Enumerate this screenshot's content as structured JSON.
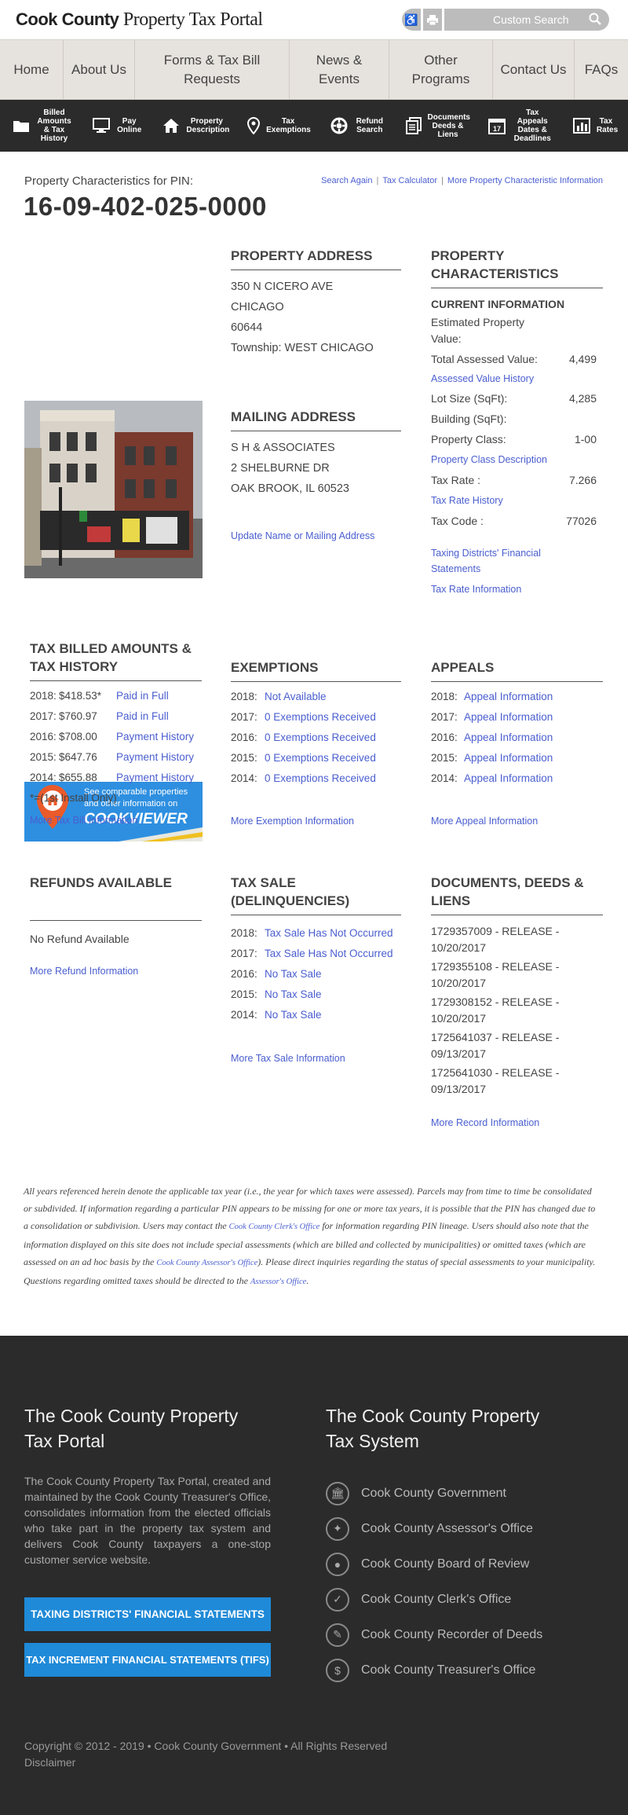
{
  "header": {
    "logo_bold": "Cook County",
    "logo_rest": "Property Tax Portal",
    "search_placeholder": "Custom Search",
    "icons": [
      "accessibility-icon",
      "print-icon",
      "search-icon"
    ]
  },
  "nav": [
    "Home",
    "About Us",
    "Forms & Tax Bill Requests",
    "News & Events",
    "Other Programs",
    "Contact Us",
    "FAQs"
  ],
  "iconbar": [
    {
      "icon": "folder-icon",
      "label": "Billed Amounts & Tax History"
    },
    {
      "icon": "monitor-icon",
      "label": "Pay Online"
    },
    {
      "icon": "home-icon",
      "label": "Property Description"
    },
    {
      "icon": "map-pin-icon",
      "label": "Tax Exemptions"
    },
    {
      "icon": "lifebuoy-icon",
      "label": "Refund Search"
    },
    {
      "icon": "documents-icon",
      "label": "Documents Deeds & Liens"
    },
    {
      "icon": "calendar-icon",
      "label": "Tax Appeals Dates & Deadlines"
    },
    {
      "icon": "bar-chart-icon",
      "label": "Tax Rates"
    }
  ],
  "pin": {
    "label": "Property Characteristics for PIN:",
    "number": "16-09-402-025-0000",
    "links": [
      "Search Again",
      "Tax Calculator",
      "More Property Characteristic Information"
    ]
  },
  "cookviewer": {
    "line1": "See comparable properties",
    "line2": "and other information on",
    "brand": "COOKVIEWER"
  },
  "property_address": {
    "title": "PROPERTY ADDRESS",
    "street": "350 N CICERO AVE",
    "city": "CHICAGO",
    "zip": "60644",
    "township": "Township: WEST CHICAGO"
  },
  "mailing_address": {
    "title": "MAILING ADDRESS",
    "name": "S H & ASSOCIATES",
    "street": "2 SHELBURNE DR",
    "city": "OAK BROOK, IL 60523",
    "update_link": "Update Name or Mailing Address"
  },
  "characteristics": {
    "title": "PROPERTY CHARACTERISTICS",
    "subtitle": "CURRENT INFORMATION",
    "est_label": "Estimated Property Value:",
    "tav_label": "Total Assessed Value:",
    "tav_value": "4,499",
    "tav_link": "Assessed Value History",
    "lot_label": "Lot Size (SqFt):",
    "lot_value": "4,285",
    "bldg_label": "Building (SqFt):",
    "class_label": "Property Class:",
    "class_value": "1-00",
    "class_link": "Property Class Description",
    "rate_label": "Tax Rate :",
    "rate_value": "7.266",
    "rate_link": "Tax Rate History",
    "code_label": "Tax Code :",
    "code_value": "77026",
    "link_financial": "Taxing Districts' Financial Statements",
    "link_rate_info": "Tax Rate Information"
  },
  "tax_billed": {
    "title": "TAX BILLED AMOUNTS & TAX HISTORY",
    "rows": [
      {
        "year": "2018:",
        "amount": "$418.53*",
        "link": "Paid in Full"
      },
      {
        "year": "2017:",
        "amount": "$760.97",
        "link": "Paid in Full"
      },
      {
        "year": "2016:",
        "amount": "$708.00",
        "link": "Payment History"
      },
      {
        "year": "2015:",
        "amount": "$647.76",
        "link": "Payment History"
      },
      {
        "year": "2014:",
        "amount": "$655.88",
        "link": "Payment History"
      }
    ],
    "note": "*=(1st Install Only)",
    "more": "More Tax Bill Information"
  },
  "exemptions": {
    "title": "EXEMPTIONS",
    "rows": [
      {
        "year": "2018:",
        "link": "Not Available"
      },
      {
        "year": "2017:",
        "link": "0 Exemptions Received"
      },
      {
        "year": "2016:",
        "link": "0 Exemptions Received"
      },
      {
        "year": "2015:",
        "link": "0 Exemptions Received"
      },
      {
        "year": "2014:",
        "link": "0 Exemptions Received"
      }
    ],
    "more": "More Exemption Information"
  },
  "appeals": {
    "title": "APPEALS",
    "rows": [
      {
        "year": "2018:",
        "link": "Appeal Information"
      },
      {
        "year": "2017:",
        "link": "Appeal Information"
      },
      {
        "year": "2016:",
        "link": "Appeal Information"
      },
      {
        "year": "2015:",
        "link": "Appeal Information"
      },
      {
        "year": "2014:",
        "link": "Appeal Information"
      }
    ],
    "more": "More Appeal Information"
  },
  "refunds": {
    "title": "REFUNDS AVAILABLE",
    "status": "No Refund Available",
    "more": "More Refund Information"
  },
  "tax_sale": {
    "title": "TAX SALE (DELINQUENCIES)",
    "rows": [
      {
        "year": "2018:",
        "link": "Tax Sale Has Not Occurred"
      },
      {
        "year": "2017:",
        "link": "Tax Sale Has Not Occurred"
      },
      {
        "year": "2016:",
        "link": "No Tax Sale"
      },
      {
        "year": "2015:",
        "link": "No Tax Sale"
      },
      {
        "year": "2014:",
        "link": "No Tax Sale"
      }
    ],
    "more": "More Tax Sale Information"
  },
  "documents": {
    "title": "DOCUMENTS, DEEDS & LIENS",
    "rows": [
      "1729357009 - RELEASE - 10/20/2017",
      "1729355108 - RELEASE - 10/20/2017",
      "1729308152 - RELEASE - 10/20/2017",
      "1725641037 - RELEASE - 09/13/2017",
      "1725641030 - RELEASE - 09/13/2017"
    ],
    "more": "More Record Information"
  },
  "disclaimer": {
    "p1": "All years referenced herein denote the applicable tax year (i.e., the year for which taxes were assessed). Parcels may from time to time be consolidated or subdivided. If information regarding a particular PIN appears to be missing for one or more tax years, it is possible that the PIN has changed due to a consolidation or subdivision. Users may contact the",
    "link1": "Cook County Clerk's Office",
    "p2": "for information regarding PIN lineage. Users should also note that the information displayed on this site does not include special assessments (which are billed and collected by municipalities) or omitted taxes (which are assessed on an ad hoc basis by the",
    "link2": "Cook County Assessor's Office",
    "p3": "). Please direct inquiries regarding the status of special assessments to your municipality. Questions regarding omitted taxes should be directed to the",
    "link3": "Assessor's Office",
    "p4": "."
  },
  "footer": {
    "left_title": "The Cook County Property Tax Portal",
    "left_desc": "The Cook County Property Tax Portal, created and maintained by the Cook County Treasurer's Office, consolidates information from the elected officials who take part in the property tax system and delivers Cook County taxpayers a one-stop customer service website.",
    "btn1": "TAXING DISTRICTS' FINANCIAL STATEMENTS",
    "btn2": "TAX INCREMENT FINANCIAL STATEMENTS (TIFS)",
    "right_title": "The Cook County Property Tax System",
    "links": [
      {
        "icon": "government-icon",
        "label": "Cook County Government"
      },
      {
        "icon": "assessor-icon",
        "label": "Cook County Assessor's Office"
      },
      {
        "icon": "board-of-review-icon",
        "label": "Cook County Board of Review"
      },
      {
        "icon": "checkmark-icon",
        "label": "Cook County Clerk's Office"
      },
      {
        "icon": "pencil-icon",
        "label": "Cook County Recorder of Deeds"
      },
      {
        "icon": "dollar-icon",
        "label": "Cook County Treasurer's Office"
      }
    ],
    "copyright": "Copyright © 2012 - 2019 • Cook County Government • All Rights Reserved",
    "disclaimer": "Disclaimer"
  }
}
